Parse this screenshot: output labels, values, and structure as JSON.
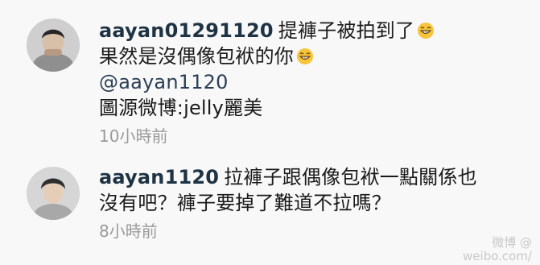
{
  "comments": [
    {
      "username": "aayan01291120",
      "lines": [
        "提褲子被拍到了",
        "果然是沒偶像包袱的你"
      ],
      "mention": "@aayan1120",
      "source": "圖源微博:jelly麗美",
      "time": "10小時前",
      "emoji_icon": "grinning-face-icon"
    },
    {
      "username": "aayan1120",
      "lines": [
        "拉褲子跟偶像包袱一點關係也",
        "沒有吧？褲子要掉了難道不拉嗎？"
      ],
      "time": "8小時前"
    }
  ],
  "watermark": {
    "line1": "微博 @",
    "line2": "weibo.com/"
  }
}
